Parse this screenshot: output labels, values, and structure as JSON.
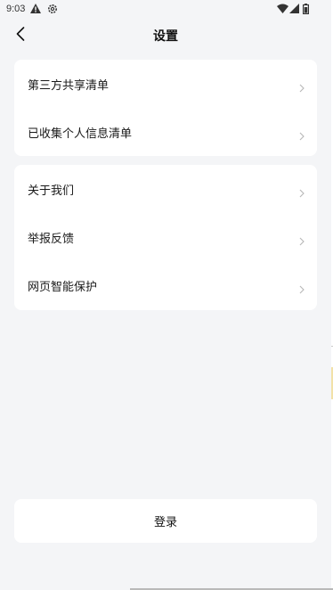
{
  "status_bar": {
    "time": "9:03",
    "icons": [
      "warning-icon",
      "gear-icon",
      "wifi-icon",
      "signal-icon",
      "battery-icon"
    ]
  },
  "header": {
    "title": "设置",
    "back_icon": "chevron-left-icon"
  },
  "sections": [
    {
      "items": [
        {
          "label": "第三方共享清单"
        },
        {
          "label": "已收集个人信息清单"
        }
      ]
    },
    {
      "items": [
        {
          "label": "关于我们"
        },
        {
          "label": "举报反馈"
        },
        {
          "label": "网页智能保护"
        }
      ]
    }
  ],
  "login": {
    "label": "登录"
  },
  "colors": {
    "background": "#f4f5f7",
    "card": "#ffffff",
    "text": "#111111",
    "chevron": "#b8b8b8"
  }
}
